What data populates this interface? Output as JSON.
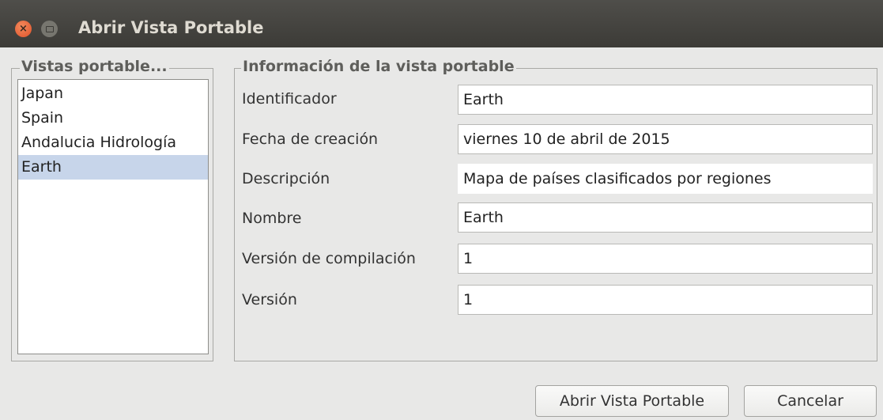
{
  "window": {
    "title": "Abrir Vista Portable",
    "close_glyph": "×"
  },
  "views_group": {
    "title": "Vistas portable...",
    "items": [
      "Japan",
      "Spain",
      "Andalucia Hidrología",
      "Earth"
    ],
    "selected": "Earth"
  },
  "info_group": {
    "title": "Información de la vista portable",
    "fields": [
      {
        "label": "Identificador",
        "value": "Earth"
      },
      {
        "label": "Fecha de creación",
        "value": "viernes 10 de abril de 2015"
      },
      {
        "label": "Descripción",
        "value": "Mapa de países clasificados por regiones"
      },
      {
        "label": "Nombre",
        "value": "Earth"
      },
      {
        "label": "Versión de compilación",
        "value": "1"
      },
      {
        "label": "Versión",
        "value": "1"
      }
    ]
  },
  "buttons": {
    "open_label": "Abrir Vista Portable",
    "cancel_label": "Cancelar"
  },
  "colors": {
    "titlebar": "#3c3b37",
    "selection": "#c7d5ea",
    "close_button": "#e0522a"
  }
}
